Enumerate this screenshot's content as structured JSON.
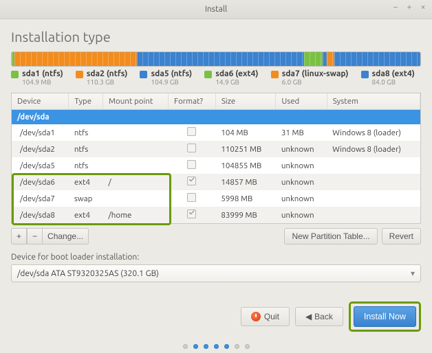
{
  "window": {
    "title": "Install"
  },
  "page": {
    "heading": "Installation type"
  },
  "colors": {
    "green": "#7ac142",
    "orange": "#f28c1d",
    "blue": "#3b82cf",
    "lime": "#6a9a00"
  },
  "usage_segments": [
    {
      "color": "#7ac142",
      "pct": 0.6
    },
    {
      "color": "#f28c1d",
      "pct": 30
    },
    {
      "color": "#3b82cf",
      "pct": 41
    },
    {
      "color": "#7ac142",
      "pct": 4.5
    },
    {
      "color": "#3b82cf",
      "pct": 1
    },
    {
      "color": "#f28c1d",
      "pct": 1.9
    },
    {
      "color": "#3b82cf",
      "pct": 21
    }
  ],
  "legend": [
    {
      "color": "#7ac142",
      "label": "sda1 (ntfs)",
      "size": "104.9 MB"
    },
    {
      "color": "#f28c1d",
      "label": "sda2 (ntfs)",
      "size": "110.3 GB"
    },
    {
      "color": "#3b82cf",
      "label": "sda5 (ntfs)",
      "size": "104.9 GB"
    },
    {
      "color": "#7ac142",
      "label": "sda6 (ext4)",
      "size": "14.9 GB"
    },
    {
      "color": "#f28c1d",
      "label": "sda7 (linux-swap)",
      "size": "6.0 GB"
    },
    {
      "color": "#3b82cf",
      "label": "sda8 (ext4)",
      "size": "84.0 GB"
    }
  ],
  "table": {
    "headers": {
      "device": "Device",
      "type": "Type",
      "mount": "Mount point",
      "format": "Format?",
      "size": "Size",
      "used": "Used",
      "system": "System"
    },
    "group": "/dev/sda",
    "rows": [
      {
        "device": "/dev/sda1",
        "type": "ntfs",
        "mount": "",
        "format": false,
        "size": "104 MB",
        "used": "31 MB",
        "system": "Windows 8 (loader)"
      },
      {
        "device": "/dev/sda2",
        "type": "ntfs",
        "mount": "",
        "format": false,
        "size": "110251 MB",
        "used": "unknown",
        "system": "Windows 8 (loader)"
      },
      {
        "device": "/dev/sda5",
        "type": "ntfs",
        "mount": "",
        "format": false,
        "size": "104855 MB",
        "used": "unknown",
        "system": ""
      },
      {
        "device": "/dev/sda6",
        "type": "ext4",
        "mount": "/",
        "format": true,
        "size": "14857 MB",
        "used": "unknown",
        "system": ""
      },
      {
        "device": "/dev/sda7",
        "type": "swap",
        "mount": "",
        "format": false,
        "size": "5998 MB",
        "used": "unknown",
        "system": ""
      },
      {
        "device": "/dev/sda8",
        "type": "ext4",
        "mount": "/home",
        "format": true,
        "size": "83999 MB",
        "used": "unknown",
        "system": ""
      }
    ]
  },
  "toolbar": {
    "add": "+",
    "remove": "−",
    "change": "Change...",
    "new_table": "New Partition Table...",
    "revert": "Revert"
  },
  "boot": {
    "label": "Device for boot loader installation:",
    "value": "/dev/sda   ATA ST9320325AS (320.1 GB)"
  },
  "footer": {
    "quit": "Quit",
    "back": "Back",
    "install": "Install Now"
  },
  "stepper": {
    "total": 7,
    "active": [
      1,
      2,
      3,
      4
    ]
  }
}
